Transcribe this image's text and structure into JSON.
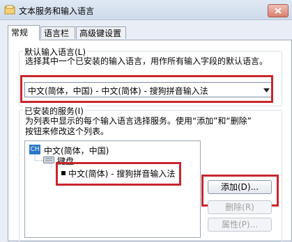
{
  "window": {
    "title": "文本服务和输入语言"
  },
  "tabs": [
    {
      "label": "常规"
    },
    {
      "label": "语言栏"
    },
    {
      "label": "高级键设置"
    }
  ],
  "default_language": {
    "group_title": "默认输入语言(L)",
    "description": "选择其中一个已安装的输入语言，用作所有输入字段的默认语言。",
    "selected_value": "中文(简体，中国) - 中文(简体) - 搜狗拼音输入法"
  },
  "installed_services": {
    "group_title": "已安装的服务(I)",
    "description_line1": "为列表中显示的每个输入语言选择服务。使用“添加”和“删除”",
    "description_line2": "按钮来修改这个列表。",
    "language_badge": "CH",
    "language_label": "中文(简体，中国)",
    "keyboard_label": "键盘",
    "service_label": "中文(简体) - 搜狗拼音输入法"
  },
  "buttons": {
    "add": "添加(D)...",
    "remove": "删除(R)",
    "properties": "属性(P)..."
  },
  "colors": {
    "highlight_box": "#c8262d",
    "badge": "#2a78c8"
  }
}
